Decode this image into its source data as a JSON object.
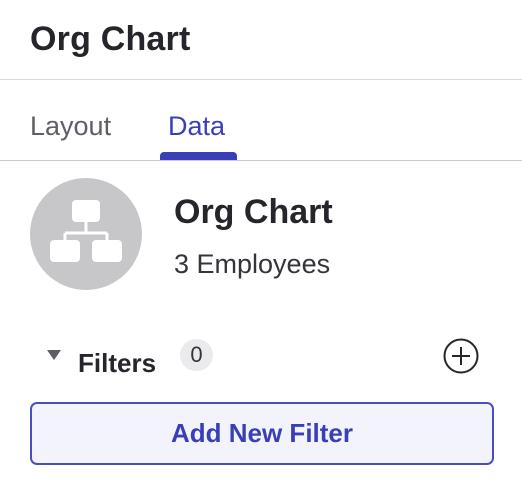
{
  "header": {
    "title": "Org Chart"
  },
  "tabs": [
    {
      "label": "Layout",
      "active": false
    },
    {
      "label": "Data",
      "active": true
    }
  ],
  "summary": {
    "icon": "org-chart-icon",
    "title": "Org Chart",
    "subtitle": "3 Employees"
  },
  "filters": {
    "label": "Filters",
    "count": "0",
    "expanded": true,
    "add_icon": "plus-circle-icon",
    "add_button_label": "Add New Filter"
  },
  "colors": {
    "accent": "#3a3fb8",
    "avatar_bg": "#c7c7c9",
    "divider": "#d8d8df",
    "button_bg": "#f3f3fc"
  }
}
